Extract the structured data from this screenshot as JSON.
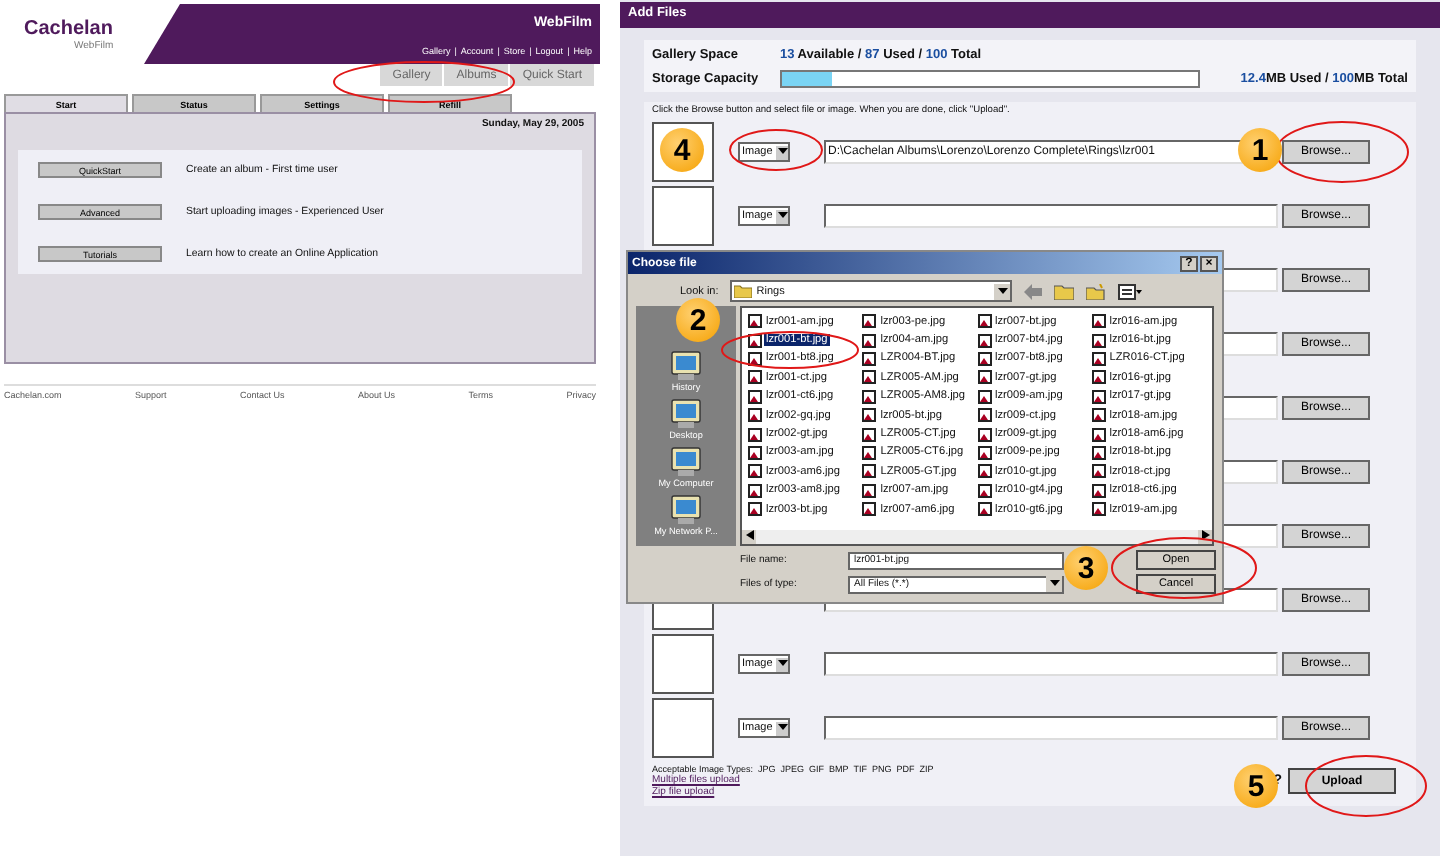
{
  "website": {
    "logo": {
      "name": "Cachelan",
      "sub": "WebFilm"
    },
    "brand": "WebFilm",
    "top_links": [
      "Gallery",
      "Account",
      "Store",
      "Logout",
      "Help"
    ],
    "top_link_separator": "|",
    "nav_tabs": [
      {
        "label": "Gallery",
        "selected": false
      },
      {
        "label": "Albums",
        "selected": false
      },
      {
        "label": "Quick Start",
        "selected": false
      }
    ],
    "tabs": [
      {
        "label": "Start",
        "selected": true
      },
      {
        "label": "Status",
        "selected": false
      },
      {
        "label": "Settings",
        "selected": false
      },
      {
        "label": "Refill",
        "selected": false
      }
    ],
    "date": "Sunday, May 29, 2005",
    "actions": [
      {
        "button": "QuickStart",
        "description": "Create an album - First time user"
      },
      {
        "button": "Advanced",
        "description": "Start uploading images - Experienced User"
      },
      {
        "button": "Tutorials",
        "description": "Learn how to create an Online Application"
      }
    ],
    "footer_links": [
      "Cachelan.com",
      "Support",
      "Contact Us",
      "About Us",
      "Terms",
      "Privacy"
    ]
  },
  "add_files": {
    "title": "Add Files",
    "gallery_space": {
      "label": "Gallery Space",
      "parts": [
        {
          "text": "13",
          "highlight": true
        },
        {
          "text": " Available / ",
          "highlight": false
        },
        {
          "text": "87",
          "highlight": true
        },
        {
          "text": " Used / ",
          "highlight": false
        },
        {
          "text": "100",
          "highlight": true
        },
        {
          "text": " Total",
          "highlight": false
        }
      ]
    },
    "storage": {
      "label": "Storage Capacity",
      "level": 0.12,
      "parts": [
        {
          "text": "12.4",
          "highlight": true
        },
        {
          "text": "MB Used / ",
          "highlight": false
        },
        {
          "text": "100",
          "highlight": true
        },
        {
          "text": "MB Total",
          "highlight": false
        }
      ]
    },
    "instruction": "Click the Browse button and select file or image. When you are done, click \"Upload\".",
    "rows": [
      {
        "select": "Image",
        "path": "D:\\Cachelan Albums\\Lorenzo\\Lorenzo Complete\\Rings\\lzr001",
        "browse": "Browse..."
      },
      {
        "select": "Image",
        "browse": "Browse..."
      },
      {
        "browse": "Browse..."
      },
      {
        "browse": "Browse..."
      },
      {
        "browse": "Browse..."
      },
      {
        "browse": "Browse..."
      },
      {
        "browse": "Browse..."
      },
      {
        "browse": "Browse..."
      },
      {
        "select": "Image",
        "browse": "Browse..."
      },
      {
        "select": "Image",
        "browse": "Browse..."
      }
    ],
    "types_label": "Acceptable Image Types:",
    "types": [
      "JPG",
      "JPEG",
      "GIF",
      "BMP",
      "TIF",
      "PNG",
      "PDF",
      "ZIP"
    ],
    "links": [
      "Multiple files upload",
      "Zip file upload"
    ],
    "help": "?",
    "upload": "Upload"
  },
  "dialog": {
    "title": "Choose file",
    "help": "?",
    "close": "×",
    "look_in_label": "Look in:",
    "folder": "Rings",
    "places": [
      "History",
      "Desktop",
      "My Computer",
      "My Network P..."
    ],
    "files": [
      {
        "name": "lzr001-am.jpg",
        "selected": false
      },
      {
        "name": "lzr001-bt.jpg",
        "selected": true
      },
      {
        "name": "lzr001-bt8.jpg",
        "selected": false
      },
      {
        "name": "lzr001-ct.jpg",
        "selected": false
      },
      {
        "name": "lzr001-ct6.jpg",
        "selected": false
      },
      {
        "name": "lzr002-gq.jpg",
        "selected": false
      },
      {
        "name": "lzr002-gt.jpg",
        "selected": false
      },
      {
        "name": "lzr003-am.jpg",
        "selected": false
      },
      {
        "name": "lzr003-am6.jpg",
        "selected": false
      },
      {
        "name": "lzr003-am8.jpg",
        "selected": false
      },
      {
        "name": "lzr003-bt.jpg",
        "selected": false
      },
      {
        "name": "lzr003-pe.jpg",
        "selected": false
      },
      {
        "name": "lzr004-am.jpg",
        "selected": false
      },
      {
        "name": "LZR004-BT.jpg",
        "selected": false
      },
      {
        "name": "LZR005-AM.jpg",
        "selected": false
      },
      {
        "name": "LZR005-AM8.jpg",
        "selected": false
      },
      {
        "name": "lzr005-bt.jpg",
        "selected": false
      },
      {
        "name": "LZR005-CT.jpg",
        "selected": false
      },
      {
        "name": "LZR005-CT6.jpg",
        "selected": false
      },
      {
        "name": "LZR005-GT.jpg",
        "selected": false
      },
      {
        "name": "lzr007-am.jpg",
        "selected": false
      },
      {
        "name": "lzr007-am6.jpg",
        "selected": false
      },
      {
        "name": "lzr007-bt.jpg",
        "selected": false
      },
      {
        "name": "lzr007-bt4.jpg",
        "selected": false
      },
      {
        "name": "lzr007-bt8.jpg",
        "selected": false
      },
      {
        "name": "lzr007-gt.jpg",
        "selected": false
      },
      {
        "name": "lzr009-am.jpg",
        "selected": false
      },
      {
        "name": "lzr009-ct.jpg",
        "selected": false
      },
      {
        "name": "lzr009-gt.jpg",
        "selected": false
      },
      {
        "name": "lzr009-pe.jpg",
        "selected": false
      },
      {
        "name": "lzr010-gt.jpg",
        "selected": false
      },
      {
        "name": "lzr010-gt4.jpg",
        "selected": false
      },
      {
        "name": "lzr010-gt6.jpg",
        "selected": false
      },
      {
        "name": "lzr016-am.jpg",
        "selected": false
      },
      {
        "name": "lzr016-bt.jpg",
        "selected": false
      },
      {
        "name": "LZR016-CT.jpg",
        "selected": false
      },
      {
        "name": "lzr016-gt.jpg",
        "selected": false
      },
      {
        "name": "lzr017-gt.jpg",
        "selected": false
      },
      {
        "name": "lzr018-am.jpg",
        "selected": false
      },
      {
        "name": "lzr018-am6.jpg",
        "selected": false
      },
      {
        "name": "lzr018-bt.jpg",
        "selected": false
      },
      {
        "name": "lzr018-ct.jpg",
        "selected": false
      },
      {
        "name": "lzr018-ct6.jpg",
        "selected": false
      },
      {
        "name": "lzr019-am.jpg",
        "selected": false
      }
    ],
    "file_name_label": "File name:",
    "file_name": "lzr001-bt.jpg",
    "type_label": "Files of type:",
    "type": "All Files (*.*)",
    "buttons": [
      "Open",
      "Cancel"
    ]
  },
  "markers": [
    "1",
    "2",
    "3",
    "4",
    "5"
  ]
}
